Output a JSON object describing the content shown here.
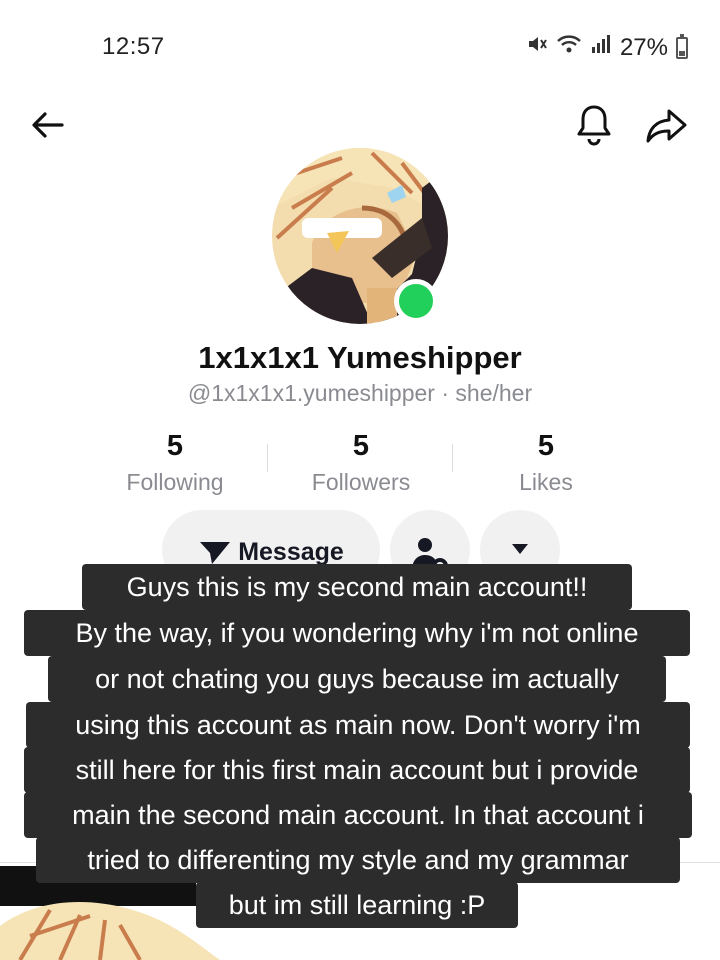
{
  "status": {
    "time": "12:57",
    "battery": "27%",
    "icons": [
      "mute-icon",
      "wifi-icon",
      "signal-icon",
      "battery-icon"
    ]
  },
  "nav": {
    "icons": [
      "back-arrow-icon",
      "bell-icon",
      "share-icon"
    ]
  },
  "profile": {
    "display_name": "1x1x1x1 Yumeshipper",
    "handle": "@1x1x1x1.yumeshipper · she/her",
    "online_color": "#20d05a"
  },
  "stats": [
    {
      "value": "5",
      "label": "Following"
    },
    {
      "value": "5",
      "label": "Followers"
    },
    {
      "value": "5",
      "label": "Likes"
    }
  ],
  "actions": {
    "message_label": "Message",
    "icons": [
      "send-icon",
      "user-settings-icon",
      "dropdown-icon"
    ]
  },
  "overlay_text": [
    "Guys this is my second main account!!",
    "By the way, if you wondering why i'm not online",
    "or not chating you guys because im actually",
    "using this account as main now. Don't worry i'm",
    "still here for this first main account but i provide",
    "main the second main account. In that account i",
    "tried to differenting my style and my grammar",
    "but im still learning :P"
  ],
  "colors": {
    "caption_bg": "#2c2c2c",
    "button_bg": "#f1f1f2",
    "muted_text": "#8a8b91"
  }
}
